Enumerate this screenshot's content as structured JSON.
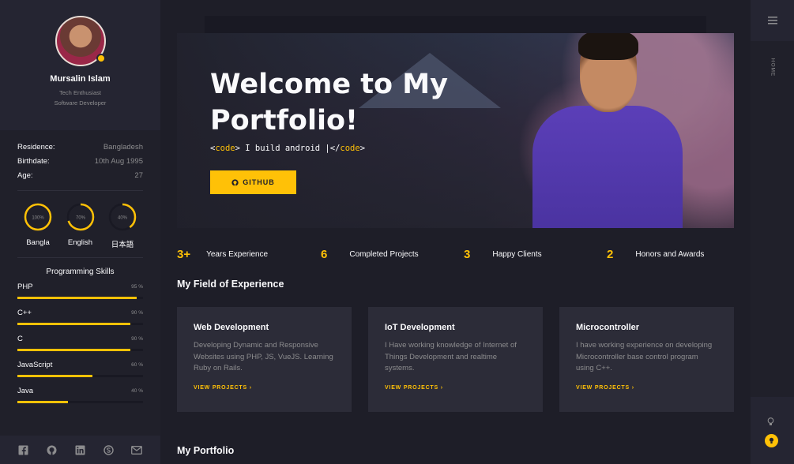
{
  "profile": {
    "name": "Mursalin Islam",
    "tagline_1": "Tech Enthusiast",
    "tagline_2": "Software Developer"
  },
  "info": [
    {
      "key": "Residence:",
      "value": "Bangladesh"
    },
    {
      "key": "Birthdate:",
      "value": "10th Aug 1995"
    },
    {
      "key": "Age:",
      "value": "27"
    }
  ],
  "languages": [
    {
      "name": "Bangla",
      "percent_label": "100%",
      "level": 1.0
    },
    {
      "name": "English",
      "percent_label": "70%",
      "level": 0.7
    },
    {
      "name": "日本語",
      "percent_label": "40%",
      "level": 0.4
    }
  ],
  "skills": {
    "title": "Programming Skills",
    "items": [
      {
        "name": "PHP",
        "percent_label": "95 %",
        "level": 0.95
      },
      {
        "name": "C++",
        "percent_label": "90 %",
        "level": 0.9
      },
      {
        "name": "C",
        "percent_label": "90 %",
        "level": 0.9
      },
      {
        "name": "JavaScript",
        "percent_label": "60 %",
        "level": 0.6
      },
      {
        "name": "Java",
        "percent_label": "40 %",
        "level": 0.4
      }
    ]
  },
  "social_icons": [
    "facebook-icon",
    "github-icon",
    "linkedin-icon",
    "skype-icon",
    "email-icon"
  ],
  "hero": {
    "title": "Welcome to My Portfolio!",
    "code_open": "<code>",
    "code_text": " I build android ",
    "code_close": "</code>",
    "button_label": "GITHUB"
  },
  "stats": [
    {
      "number": "3+",
      "label": "Years Experience"
    },
    {
      "number": "6",
      "label": "Completed Projects"
    },
    {
      "number": "3",
      "label": "Happy Clients"
    },
    {
      "number": "2",
      "label": "Honors and Awards"
    }
  ],
  "sections": {
    "experience_title": "My Field of Experience",
    "portfolio_title": "My Portfolio"
  },
  "cards": [
    {
      "title": "Web Development",
      "text": "Developing Dynamic and Responsive Websites using PHP, JS, VueJS. Learning Ruby on Rails.",
      "link": "VIEW PROJECTS ›"
    },
    {
      "title": "IoT Development",
      "text": "I Have working knowledge of Internet of Things Development and realtime systems.",
      "link": "VIEW PROJECTS ›"
    },
    {
      "title": "Microcontroller",
      "text": "I have working experience on developing Microcontroller base control program using C++.",
      "link": "VIEW PROJECTS ›"
    }
  ],
  "rail": {
    "home_label": "HOME"
  },
  "colors": {
    "accent": "#ffc107",
    "background": "#1e1e28",
    "panel": "#20202a",
    "card": "#2c2c38"
  }
}
